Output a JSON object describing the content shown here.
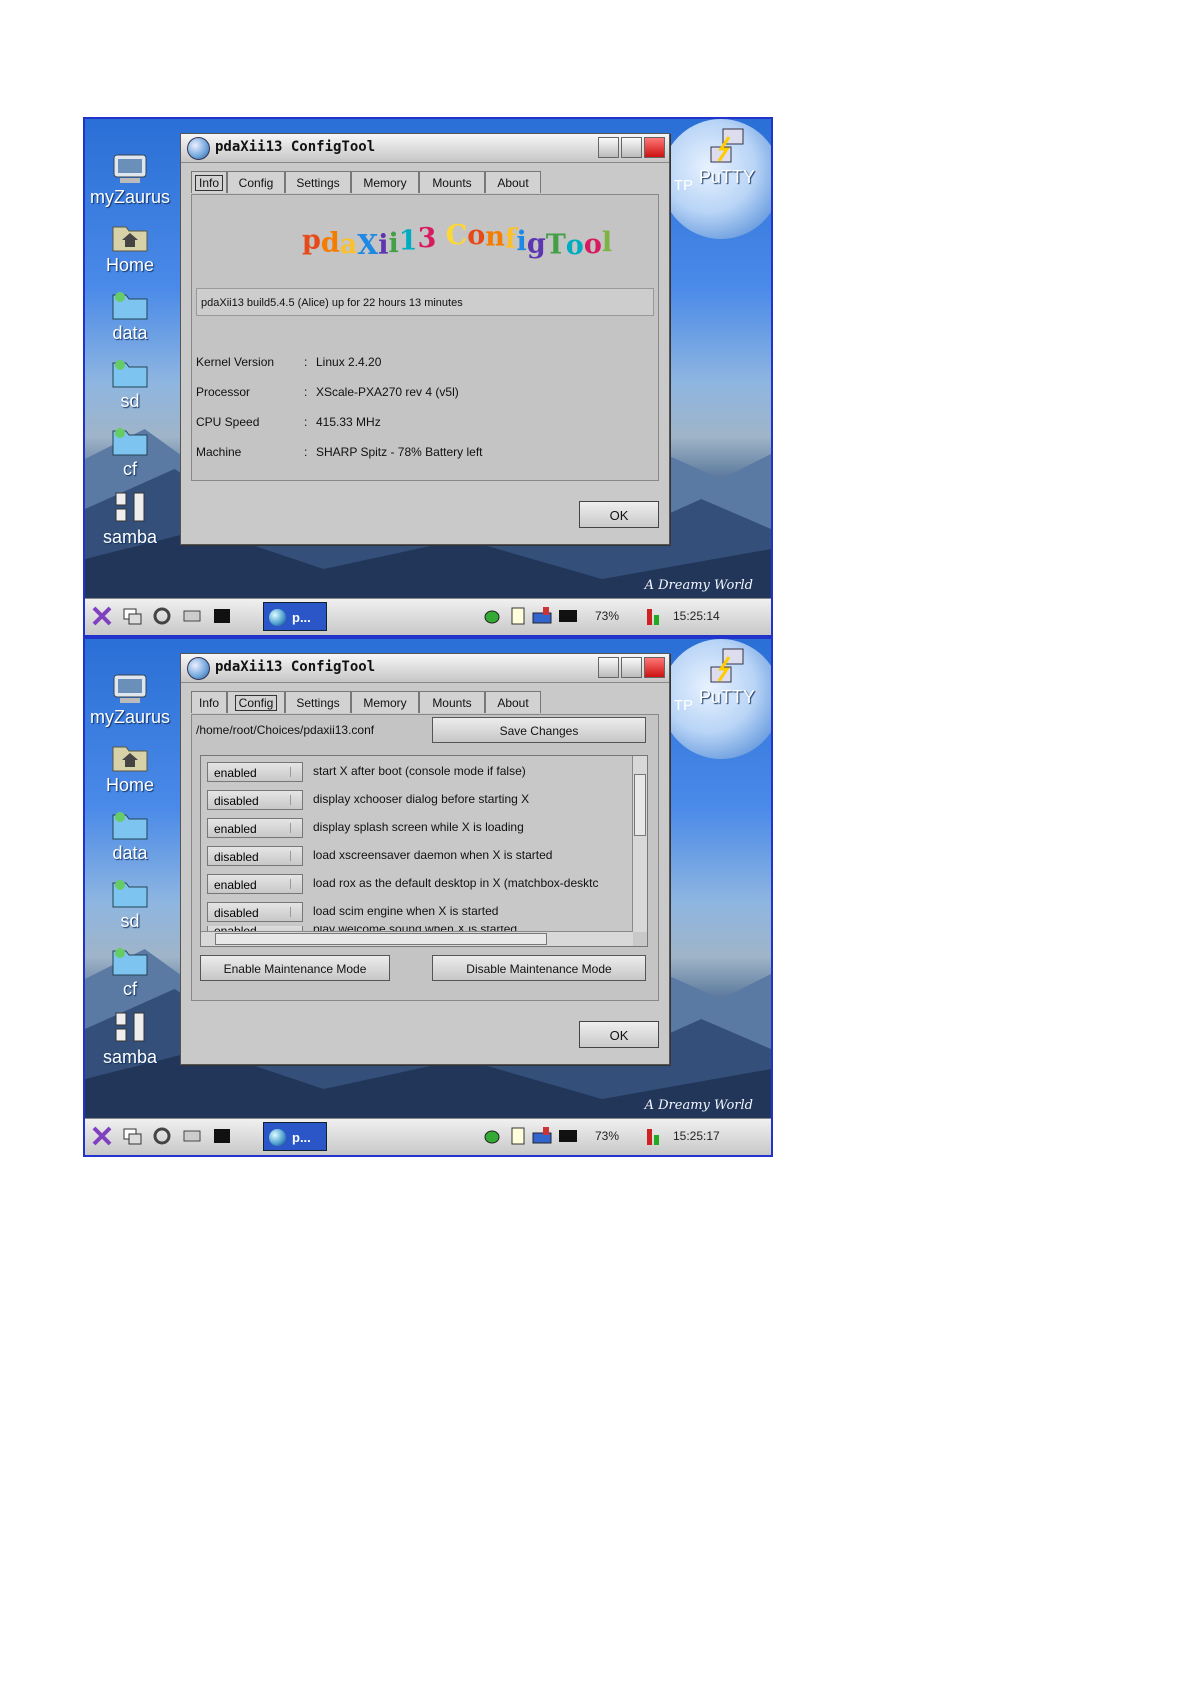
{
  "screens": [
    {
      "window_title": "pdaXii13 ConfigTool",
      "active_tab": "Info",
      "tabs": [
        "Info",
        "Config",
        "Settings",
        "Memory",
        "Mounts",
        "About"
      ],
      "logo_text": "pdaXii13 ConfigTool",
      "uptime": "pdaXii13 build5.4.5 (Alice) up for 22 hours 13 minutes",
      "info": [
        {
          "key": "Kernel Version",
          "sep": ":",
          "value": "Linux 2.4.20"
        },
        {
          "key": "Processor",
          "sep": ":",
          "value": "XScale-PXA270 rev 4 (v5l)"
        },
        {
          "key": "CPU Speed",
          "sep": ":",
          "value": "415.33 MHz"
        },
        {
          "key": "Machine",
          "sep": ":",
          "value": "SHARP Spitz  -  78% Battery left"
        }
      ],
      "ok_label": "OK",
      "taskbar": {
        "task_label": "p...",
        "battery": "73%",
        "clock": "15:25:14"
      }
    },
    {
      "window_title": "pdaXii13 ConfigTool",
      "active_tab": "Config",
      "tabs": [
        "Info",
        "Config",
        "Settings",
        "Memory",
        "Mounts",
        "About"
      ],
      "config_path": "/home/root/Choices/pdaxii13.conf",
      "save_label": "Save Changes",
      "options": [
        {
          "state": "enabled",
          "desc": "start X after boot (console mode if false)"
        },
        {
          "state": "disabled",
          "desc": "display xchooser dialog before starting X"
        },
        {
          "state": "enabled",
          "desc": "display splash screen while X is loading"
        },
        {
          "state": "disabled",
          "desc": "load xscreensaver daemon when X is started"
        },
        {
          "state": "enabled",
          "desc": "load rox as the default desktop in X (matchbox-desktc"
        },
        {
          "state": "disabled",
          "desc": "load scim engine when X is started"
        },
        {
          "state": "enabled",
          "desc": "play welcome sound when X is started"
        }
      ],
      "enable_maint_label": "Enable Maintenance Mode",
      "disable_maint_label": "Disable Maintenance Mode",
      "ok_label": "OK",
      "taskbar": {
        "task_label": "p...",
        "battery": "73%",
        "clock": "15:25:17"
      }
    }
  ],
  "desktop": {
    "icons": [
      "myZaurus",
      "Home",
      "data",
      "sd",
      "cf",
      "samba"
    ],
    "putty_label": "PuTTY",
    "tp_label": "TP",
    "signature": "A Dreamy World"
  },
  "colors": {
    "frame": "#2233cc",
    "taskbar_task": "#2b56c8",
    "window_bg": "#c9c9c9"
  }
}
